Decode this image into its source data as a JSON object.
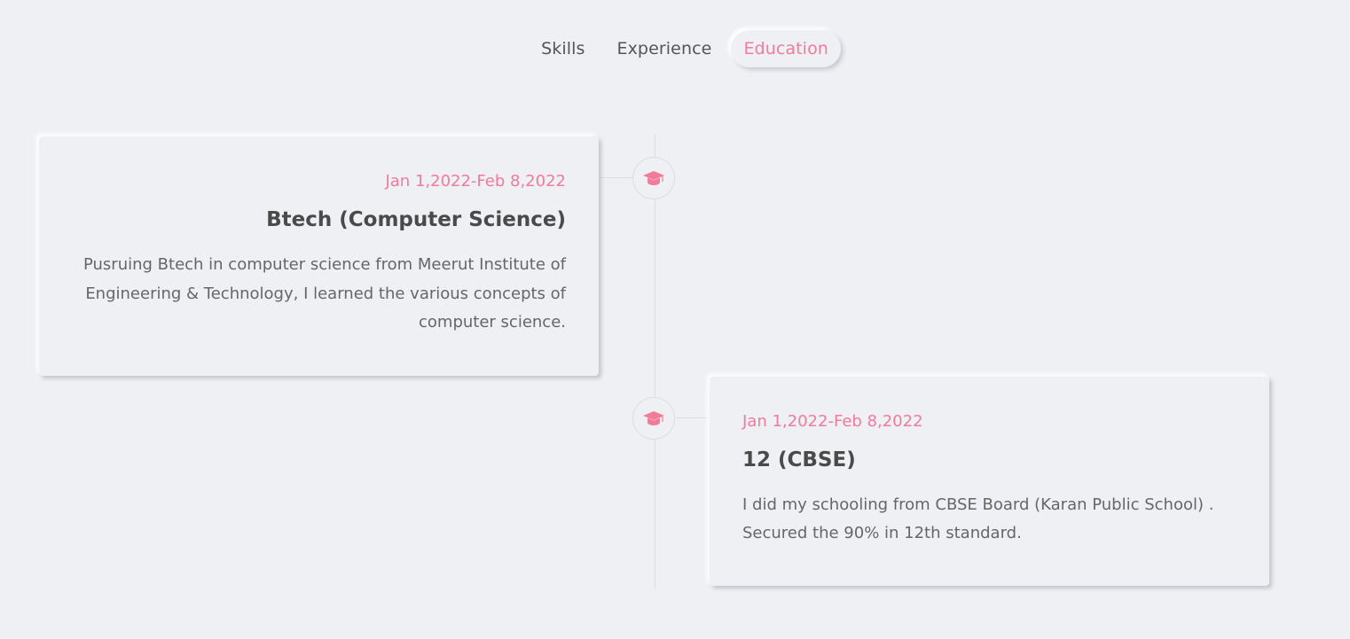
{
  "tabs": [
    {
      "label": "Skills",
      "active": false
    },
    {
      "label": "Experience",
      "active": false
    },
    {
      "label": "Education",
      "active": true
    }
  ],
  "accent_color": "#f27b9a",
  "timeline": {
    "entries": [
      {
        "side": "left",
        "icon": "graduation-cap-icon",
        "date": "Jan 1,2022-Feb 8,2022",
        "title": "Btech (Computer Science)",
        "description": "Pusruing Btech in computer science from Meerut Institute of Engineering & Technology, I learned the various concepts of computer science."
      },
      {
        "side": "right",
        "icon": "graduation-cap-icon",
        "date": "Jan 1,2022-Feb 8,2022",
        "title": "12 (CBSE)",
        "description": "I did my schooling from CBSE Board (Karan Public School) . Secured the 90% in 12th standard."
      }
    ]
  }
}
